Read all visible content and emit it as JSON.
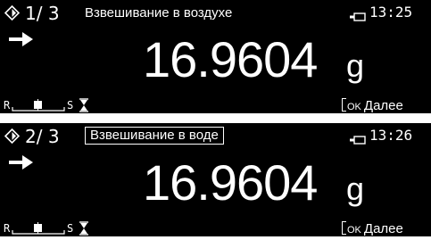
{
  "screens": [
    {
      "step": "1/ 3",
      "mode_label": "Взвешивание в воздухе",
      "mode_selected": false,
      "time": "13:25",
      "weight_value": "16.9604",
      "unit": "g",
      "status": {
        "r_label": "R",
        "s_label": "S"
      },
      "softkey": {
        "ok_label": "OK",
        "label": "Далее"
      }
    },
    {
      "step": "2/ 3",
      "mode_label": "Взвешивание в воде",
      "mode_selected": true,
      "time": "13:26",
      "weight_value": "16.9604",
      "unit": "g",
      "status": {
        "r_label": "R",
        "s_label": "S"
      },
      "softkey": {
        "ok_label": "OK",
        "label": "Далее"
      }
    }
  ],
  "icons": {
    "mode": "density-diamond-icon",
    "battery": "battery-icon",
    "arrow": "right-arrow-icon",
    "level": "level-indicator-icon",
    "stability": "stability-hourglass-icon"
  },
  "colors": {
    "screen_bg": "#000000",
    "text": "#ffffff",
    "page_bg": "#ffffff"
  }
}
